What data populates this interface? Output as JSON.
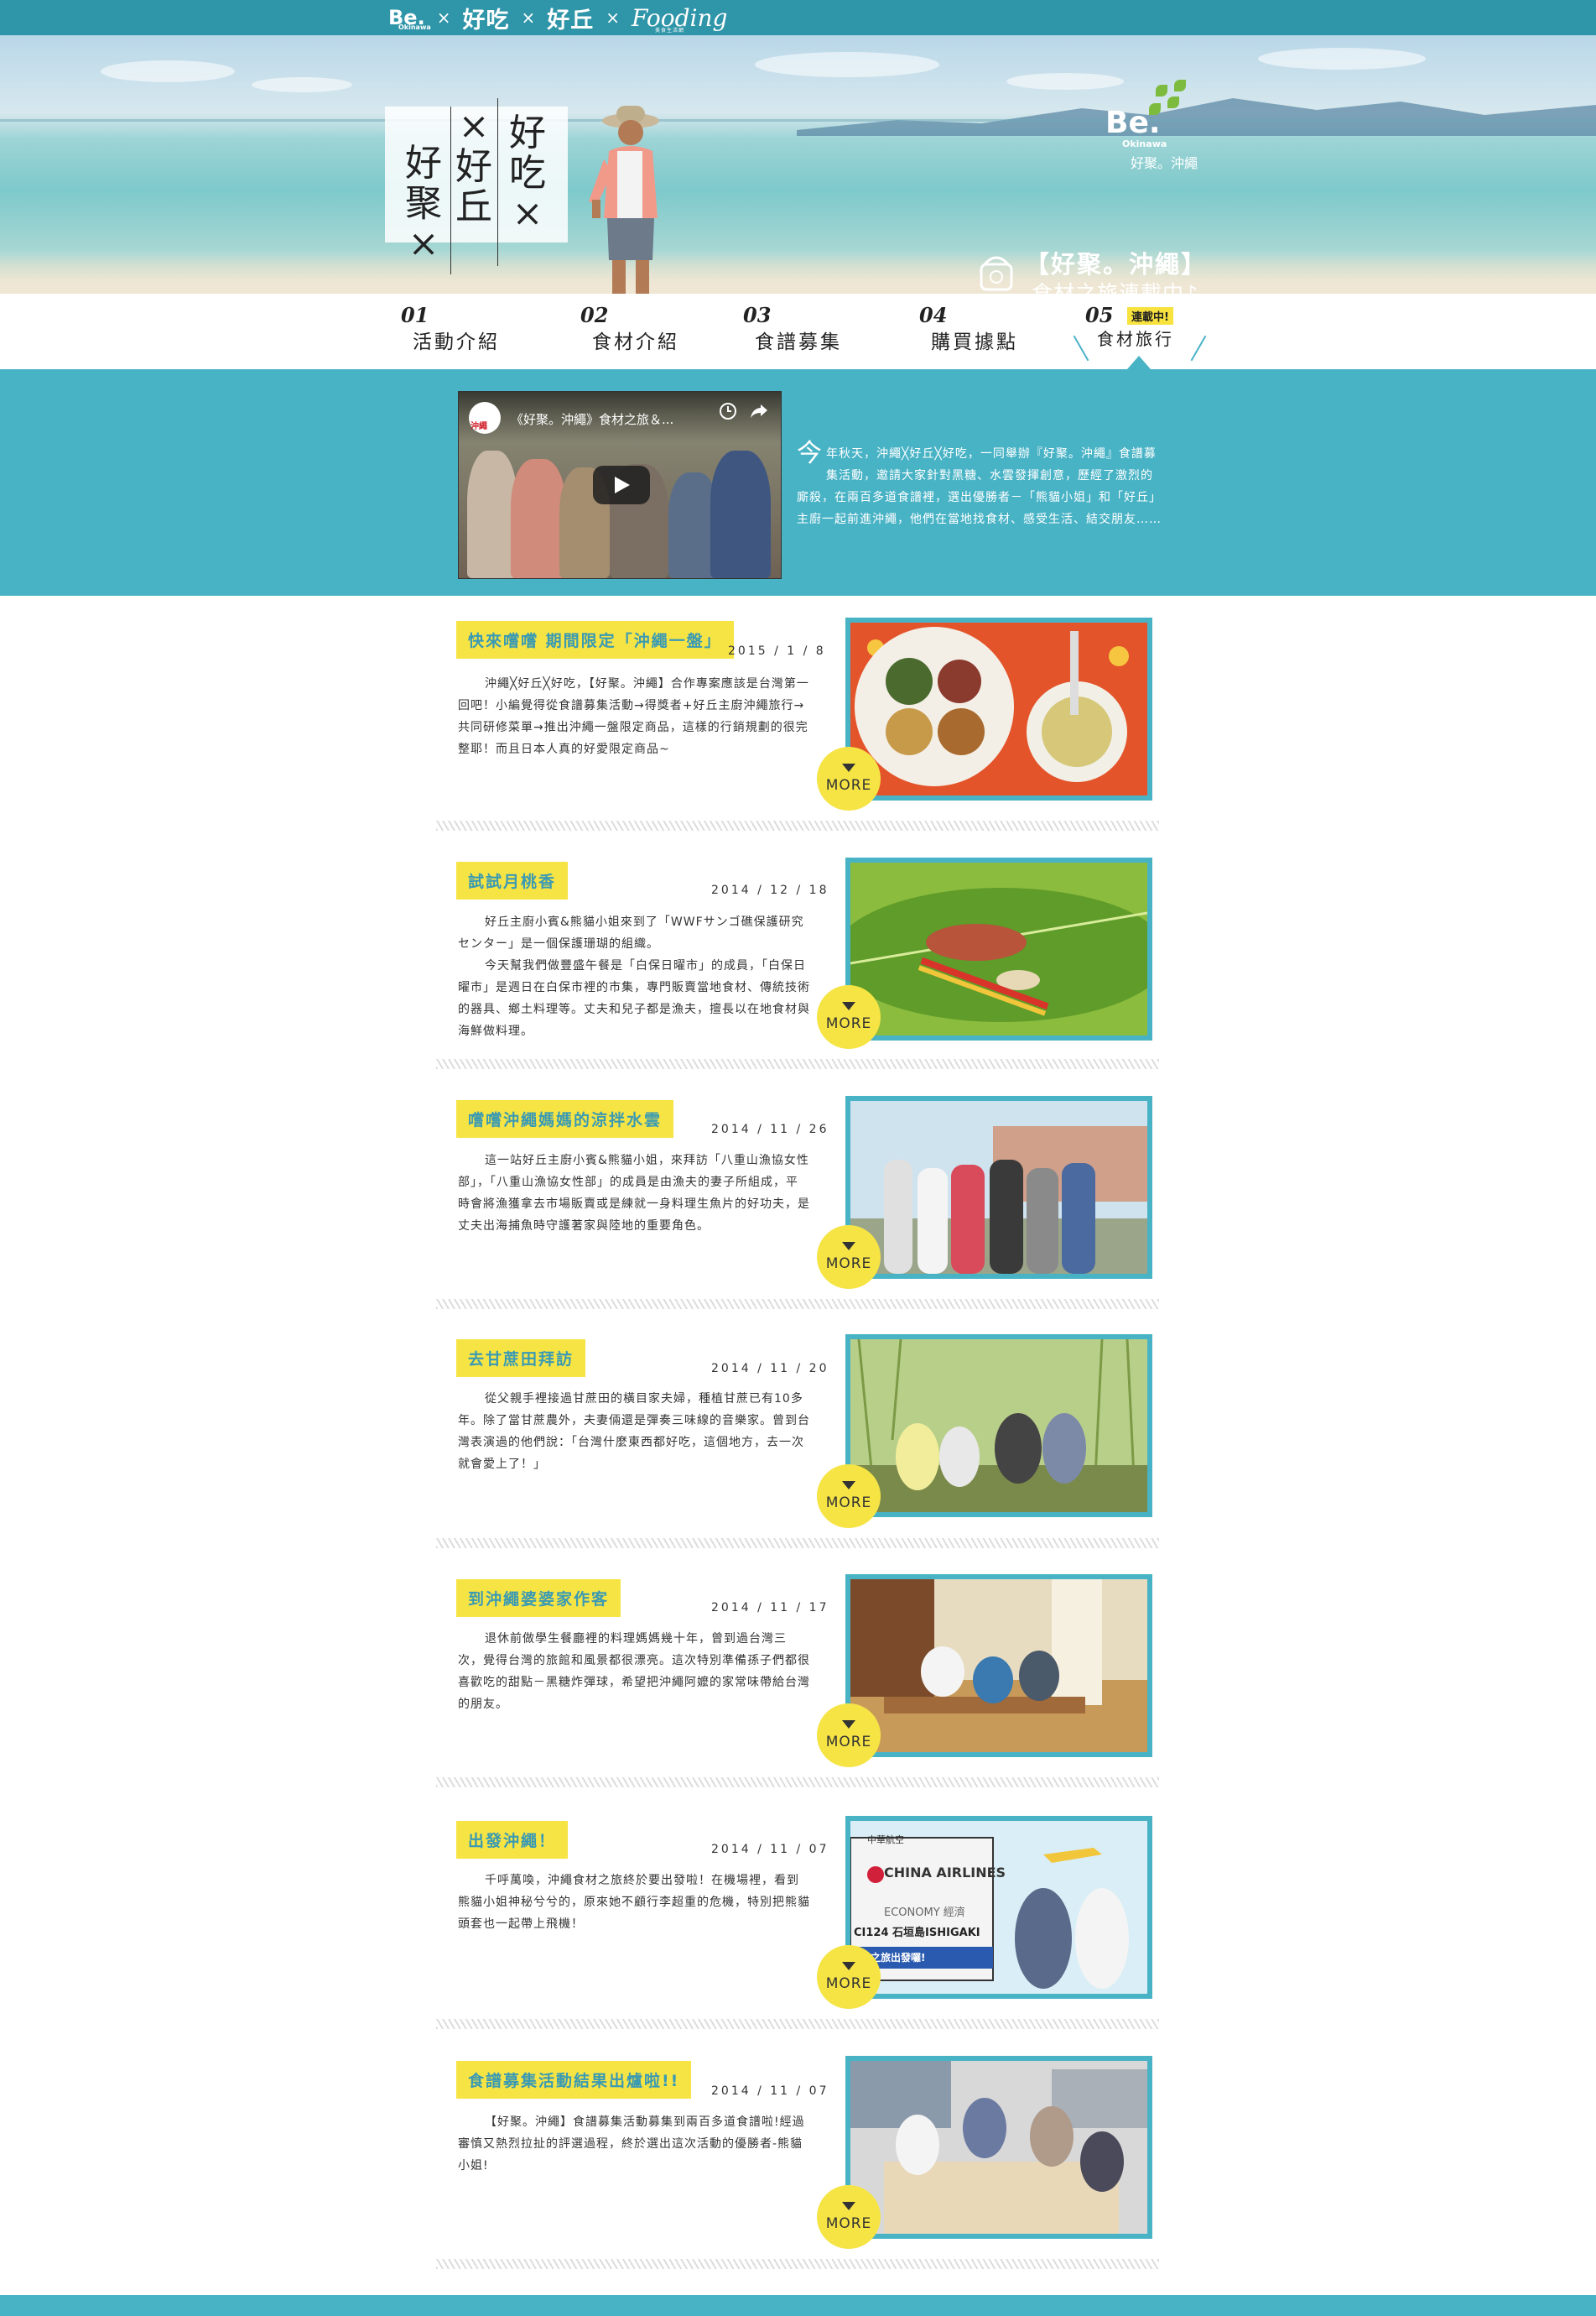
{
  "brand_bar": {
    "be": "Be.",
    "be_sub": "Okinawa",
    "sep": "×",
    "haochi": "好吃",
    "haoqiu": "好丘",
    "fooding": "Fooding",
    "fooding_sub": "美食生活網"
  },
  "hero": {
    "title_col1": "好聚×",
    "title_col2": "×好丘",
    "title_col3": "好吃×",
    "logo_be": "Be.",
    "logo_sub": "Okinawa",
    "logo_caption": "好聚。沖繩",
    "promo_line1": "【好聚。沖繩】",
    "promo_line2": "食材之旅連載中♪"
  },
  "nav": {
    "items": [
      {
        "num": "01",
        "label": "活動介紹"
      },
      {
        "num": "02",
        "label": "食材介紹"
      },
      {
        "num": "03",
        "label": "食譜募集"
      },
      {
        "num": "04",
        "label": "購買據點"
      },
      {
        "num": "05",
        "label": "食材旅行",
        "badge": "連載中!"
      }
    ]
  },
  "intro": {
    "video_title": "《好聚。沖繩》食材之旅＆...",
    "video_logo": "沖繩",
    "lead_char": "今",
    "text": "年秋天，沖繩╳好丘╳好吃，一同舉辦『好聚。沖繩』食譜募集活動，邀請大家針對黑糖、水雲發揮創意，歷經了激烈的廝殺，在兩百多道食譜裡，選出優勝者－「熊貓小姐」和「好丘」主廚一起前進沖繩，他們在當地找食材、感受生活、結交朋友……"
  },
  "articles": [
    {
      "tag": "快來嚐嚐 期間限定「沖繩一盤」",
      "date": "2015 / 1 / 8",
      "paragraphs": [
        "沖繩╳好丘╳好吃，【好聚。沖繩】合作專案應該是台灣第一回吧！小編覺得從食譜募集活動→得獎者+好丘主廚沖繩旅行→共同研修菜單→推出沖繩一盤限定商品，這樣的行銷規劃的很完整耶！而且日本人真的好愛限定商品~"
      ],
      "more": "MORE"
    },
    {
      "tag": "試試月桃香",
      "date": "2014 / 12 / 18",
      "paragraphs": [
        "好丘主廚小賓&熊貓小姐來到了「WWFサンゴ礁保護研究センター」是一個保護珊瑚的組織。",
        "今天幫我們做豐盛午餐是「白保日曜市」的成員，「白保日曜市」是週日在白保市裡的市集，專門販賣當地食材、傳統技術的器具、鄉土料理等。丈夫和兒子都是漁夫，擅長以在地食材與海鮮做料理。"
      ],
      "more": "MORE"
    },
    {
      "tag": "嚐嚐沖繩媽媽的涼拌水雲",
      "date": "2014 / 11 / 26",
      "paragraphs": [
        "這一站好丘主廚小賓&熊貓小姐，來拜訪「八重山漁協女性部」，「八重山漁協女性部」的成員是由漁夫的妻子所組成，平時會將漁獲拿去市場販賣或是練就一身料理生魚片的好功夫，是丈夫出海捕魚時守護著家與陸地的重要角色。"
      ],
      "more": "MORE"
    },
    {
      "tag": "去甘蔗田拜訪",
      "date": "2014 / 11 / 20",
      "paragraphs": [
        "從父親手裡接過甘蔗田的橫目家夫婦，種植甘蔗已有10多年。除了當甘蔗農外，夫妻倆還是彈奏三味線的音樂家。曾到台灣表演過的他們說：「台灣什麼東西都好吃，這個地方，去一次就會愛上了！」"
      ],
      "more": "MORE"
    },
    {
      "tag": "到沖繩婆婆家作客",
      "date": "2014 / 11 / 17",
      "paragraphs": [
        "退休前做學生餐廳裡的料理媽媽幾十年，曾到過台灣三次，覺得台灣的旅館和風景都很漂亮。這次特別準備孫子們都很喜歡吃的甜點－黑糖炸彈球，希望把沖繩阿嬤的家常味帶給台灣的朋友。"
      ],
      "more": "MORE"
    },
    {
      "tag": "出發沖繩！",
      "date": "2014 / 11 / 07",
      "paragraphs": [
        "千呼萬喚，沖繩食材之旅終於要出發啦！在機場裡，看到熊貓小姐神秘兮兮的，原來她不顧行李超重的危機，特別把熊貓頭套也一起帶上飛機！"
      ],
      "more": "MORE",
      "photo_text": {
        "airline_cn": "中華航空",
        "airline": "CHINA AIRLINES",
        "class": "ECONOMY 經濟",
        "flight": "CI124 石垣島ISHIGAKI",
        "banner": "之旅出發囉!"
      }
    },
    {
      "tag": "食譜募集活動結果出爐啦!!",
      "date": "2014 / 11 / 07",
      "paragraphs": [
        "【好聚。沖繩】食譜募集活動募集到兩百多道食譜啦!經過審慎又熱烈拉扯的評選過程，終於選出這次活動的優勝者-熊貓小姐!"
      ],
      "more": "MORE"
    }
  ],
  "colors": {
    "teal": "#49b3c6",
    "dark_teal": "#2f95a8",
    "yellow": "#f6e445",
    "tag_text": "#3a9ab3"
  }
}
